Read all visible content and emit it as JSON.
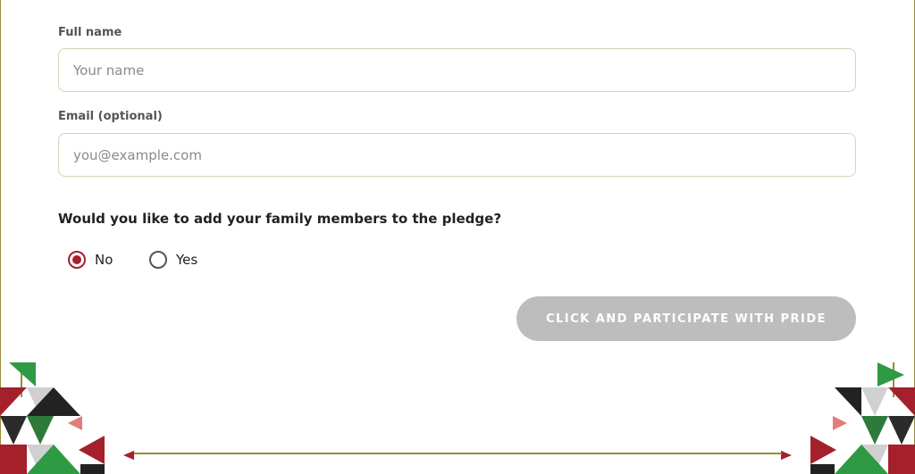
{
  "form": {
    "full_name": {
      "label": "Full name",
      "placeholder": "Your name",
      "value": ""
    },
    "email": {
      "label": "Email (optional)",
      "placeholder": "you@example.com",
      "value": ""
    },
    "family_question": "Would you like to add your family members to the pledge?",
    "family_options": [
      {
        "label": "No",
        "selected": true
      },
      {
        "label": "Yes",
        "selected": false
      }
    ],
    "submit_label": "CLICK AND PARTICIPATE WITH PRIDE"
  },
  "colors": {
    "accent_red": "#a4202b",
    "flag_green": "#2e9a44",
    "button_disabled": "#bdbdbd",
    "border_gold": "#9a8a3a"
  },
  "icons": {
    "radio_selected": "radio-selected-icon",
    "radio_unselected": "radio-unselected-icon",
    "decoration": "geometric-flag-pattern-icon"
  }
}
